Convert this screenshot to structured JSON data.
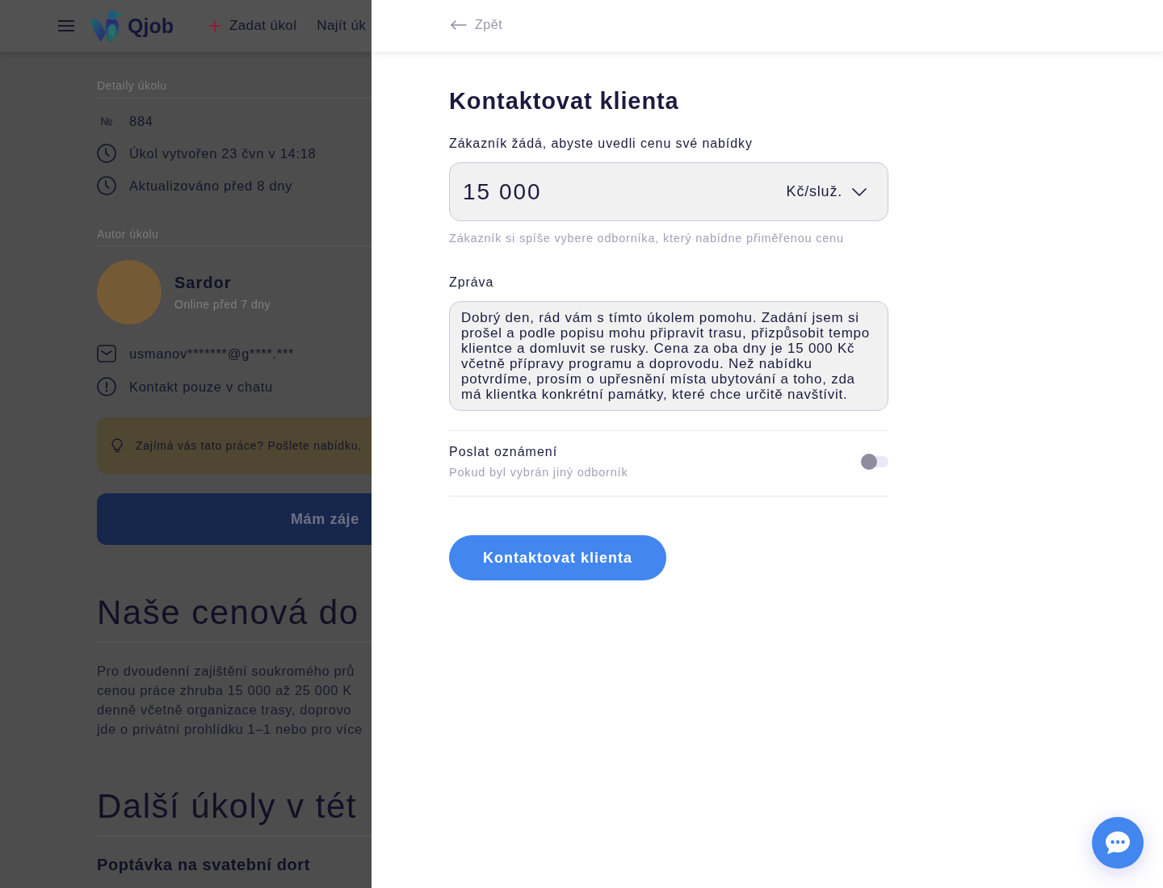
{
  "background_page": {
    "header": {
      "logo_text": "Qjob",
      "nav": [
        {
          "label": "Zadat úkol",
          "kind": "add"
        },
        {
          "label": "Najít úk",
          "kind": "plain"
        }
      ]
    },
    "task_details": {
      "heading": "Detaily úkolu",
      "rows": [
        {
          "kind": "number",
          "icon_text": "№",
          "text": "884"
        },
        {
          "kind": "clock",
          "text": "Úkol vytvořen 23 čvn v 14:18"
        },
        {
          "kind": "clock",
          "text": "Aktualizováno před 8 dny"
        }
      ]
    },
    "author": {
      "heading": "Autor úkolu",
      "name": "Sardor",
      "last_seen": "Online před 7 dny",
      "contacts": [
        {
          "kind": "mail",
          "text": "usmanov*******@g****.***"
        },
        {
          "kind": "alert",
          "text": "Kontakt pouze v chatu"
        }
      ]
    },
    "tip_banner": {
      "text": "Zajímá vás tato práce? Pošlete nabídku,"
    },
    "interest_button": {
      "label": "Mám záje"
    },
    "price_section": {
      "heading": "Naše cenová do",
      "paragraph_lines": [
        "Pro dvoudenní zajištění soukromého prů",
        "cenou práce zhruba 15 000 až 25 000 K",
        "denně včetně organizace trasy, doprovo",
        "jde o privátní prohlídku 1–1 nebo pro více"
      ]
    },
    "more_tasks": {
      "heading": "Další úkoly v tét",
      "items": [
        {
          "title": "Poptávka na svatební dort"
        }
      ]
    }
  },
  "drawer": {
    "back_link": {
      "label": "Zpět"
    },
    "title": "Kontaktovat klienta",
    "price": {
      "label": "Zákazník žádá, abyste uvedli cenu své nabídky",
      "value": "15 000",
      "unit": "Kč/služ.",
      "hint": "Zákazník si spíše vybere odborníka, který nabídne přiměřenou cenu"
    },
    "message": {
      "label": "Zpráva",
      "value": "Dobrý den, rád vám s tímto úkolem pomohu. Zadání jsem si prošel a podle popisu mohu připravit trasu, přizpůsobit tempo klientce a domluvit se rusky. Cena za oba dny je 15 000 Kč včetně přípravy programu a doprovodu. Než nabídku potvrdíme, prosím o upřesnění místa ubytování a toho, zda má klientka konkrétní památky, které chce určitě navštívit."
    },
    "notification": {
      "title": "Poslat oznámení",
      "subtitle": "Pokud byl vybrán jiný odborník",
      "on": false
    },
    "submit_button": {
      "label": "Kontaktovat klienta"
    }
  }
}
